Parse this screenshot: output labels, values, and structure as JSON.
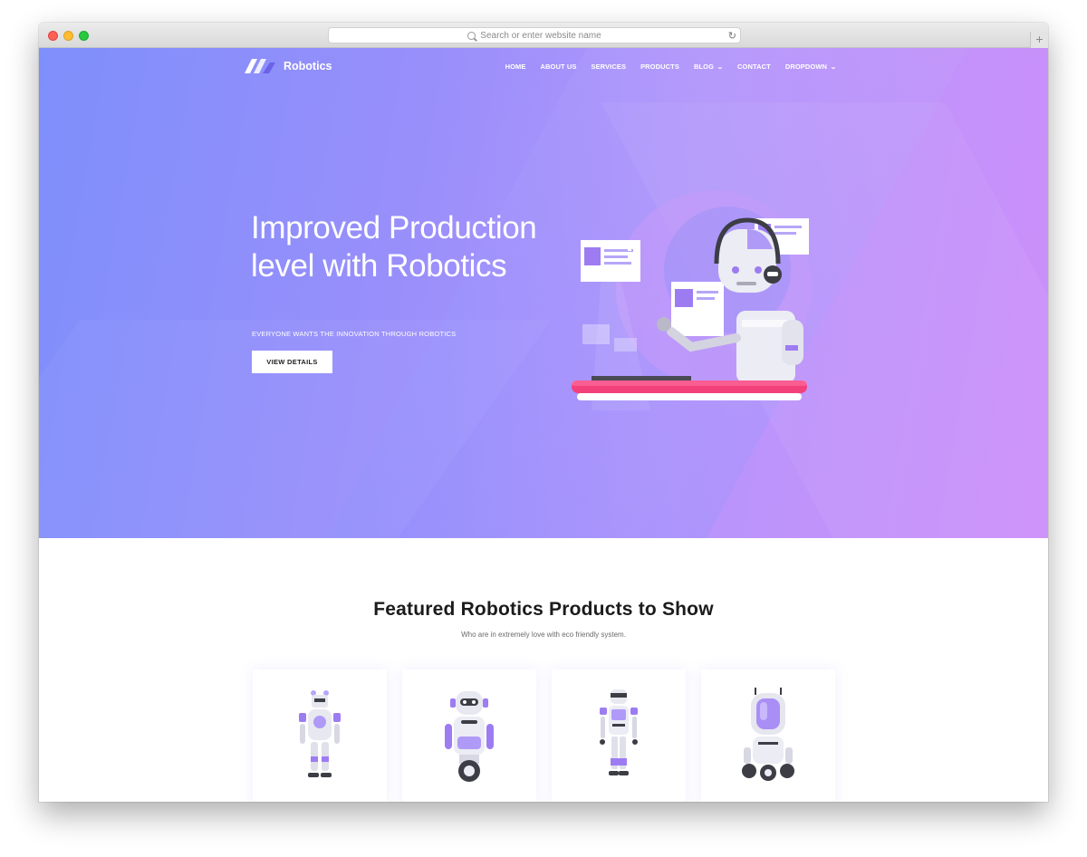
{
  "browser": {
    "address_placeholder": "Search or enter website name"
  },
  "brand": {
    "name": "Robotics"
  },
  "nav": {
    "items": [
      {
        "label": "HOME"
      },
      {
        "label": "ABOUT US"
      },
      {
        "label": "SERVICES"
      },
      {
        "label": "PRODUCTS"
      },
      {
        "label": "BLOG"
      },
      {
        "label": "CONTACT"
      },
      {
        "label": "DROPDOWN"
      }
    ]
  },
  "hero": {
    "headline": "Improved Production level with Robotics",
    "subheadline": "EVERYONE WANTS THE INNOVATION THROUGH ROBOTICS",
    "cta_label": "VIEW DETAILS"
  },
  "featured": {
    "title": "Featured Robotics Products to Show",
    "subtitle": "Who are in extremely love with eco friendly system."
  },
  "colors": {
    "hero_gradient_start": "#7e8ffb",
    "hero_gradient_end": "#cd8ffa",
    "accent_purple": "#9d7cf2",
    "desk_pink": "#f2417a"
  }
}
